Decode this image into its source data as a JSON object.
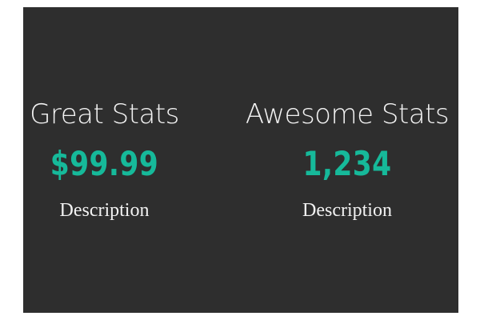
{
  "colors": {
    "panel_background": "#2e2e2e",
    "accent": "#16b99a",
    "text": "#f2f2f2"
  },
  "stats": [
    {
      "title": "Great Stats",
      "value": "$99.99",
      "description": "Description"
    },
    {
      "title": "Awesome Stats",
      "value": "1,234",
      "description": "Description"
    }
  ]
}
